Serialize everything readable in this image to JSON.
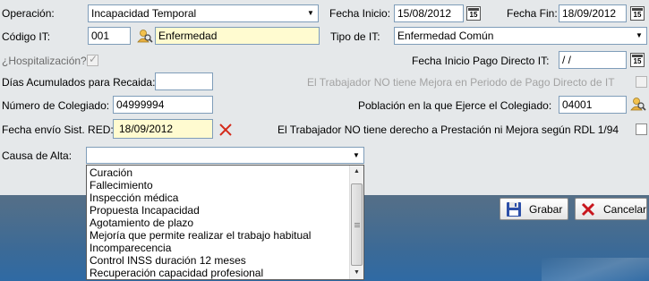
{
  "form": {
    "operacion": {
      "label": "Operación:",
      "value": "Incapacidad Temporal"
    },
    "fecha_inicio": {
      "label": "Fecha Inicio:",
      "value": "15/08/2012"
    },
    "fecha_fin": {
      "label": "Fecha Fin:",
      "value": "18/09/2012"
    },
    "codigo_it": {
      "label": "Código IT:",
      "code": "001",
      "description": "Enfermedad"
    },
    "tipo_it": {
      "label": "Tipo de IT:",
      "value": "Enfermedad Común"
    },
    "hospitalizacion": {
      "label": "¿Hospitalización?",
      "checked": true
    },
    "fecha_pago_directo": {
      "label": "Fecha Inicio Pago Directo IT:",
      "value": " / /"
    },
    "dias_acumulados": {
      "label": "Días Acumulados para Recaida:",
      "value": ""
    },
    "no_mejora_pago_directo": {
      "label": "El Trabajador NO tiene Mejora en Periodo de Pago Directo de IT",
      "checked": false
    },
    "numero_colegiado": {
      "label": "Número de Colegiado:",
      "value": "04999994"
    },
    "poblacion_colegiado": {
      "label": "Población en la que Ejerce el Colegiado:",
      "value": "04001"
    },
    "fecha_envio_red": {
      "label": "Fecha envío Sist. RED:",
      "value": "18/09/2012"
    },
    "no_derecho_prestacion": {
      "label": "El Trabajador NO tiene derecho a Prestación ni Mejora según RDL 1/94",
      "checked": false
    },
    "causa_alta": {
      "label": "Causa de Alta:",
      "value": "",
      "options": [
        "Curación",
        "Fallecimiento",
        "Inspección médica",
        "Propuesta Incapacidad",
        "Agotamiento de plazo",
        "Mejoría que permite realizar el trabajo habitual",
        "Incomparecencia",
        "Control INSS duración 12 meses",
        "Recuperación capacidad profesional"
      ]
    }
  },
  "buttons": {
    "grabar": "Grabar",
    "cancelar": "Cancelar"
  },
  "icons": {
    "calendar": "calendar-icon",
    "search": "search-person-icon",
    "clear": "clear-x-icon",
    "save": "floppy-disk-icon",
    "cancel": "red-x-icon"
  },
  "colors": {
    "background": "#e5e8ea",
    "yellow_field": "#fffbd0",
    "clear_red": "#d42a1a",
    "save_blue": "#2c4fa8"
  }
}
